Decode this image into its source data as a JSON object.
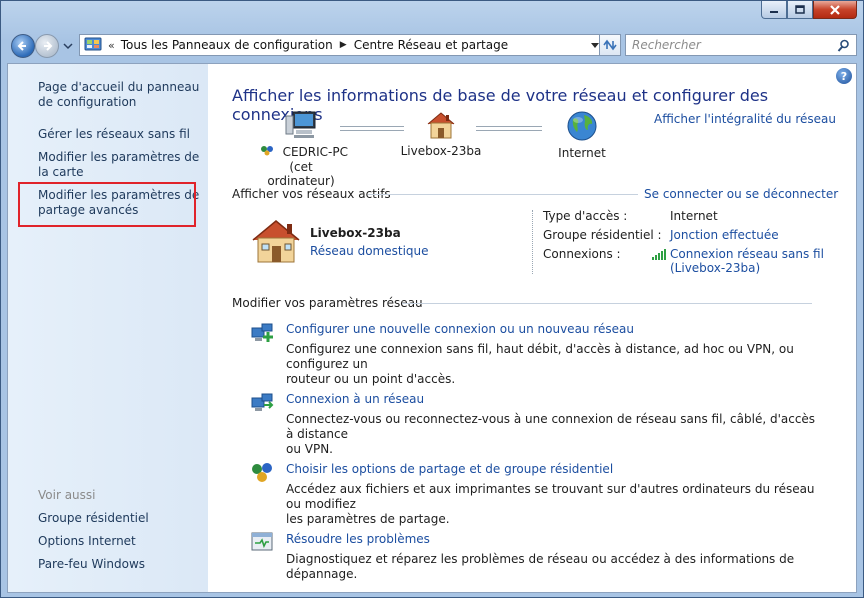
{
  "window": {
    "caption_buttons": [
      "minimize-icon",
      "maximize-icon",
      "close-icon"
    ]
  },
  "address_bar": {
    "overflow": "«",
    "crumbs": [
      "Tous les Panneaux de configuration",
      "Centre Réseau et partage"
    ],
    "search_placeholder": "Rechercher"
  },
  "sidebar": {
    "links": [
      "Page d'accueil du panneau de configuration",
      "Gérer les réseaux sans fil",
      "Modifier les paramètres de la carte",
      "Modifier les paramètres de partage avancés"
    ],
    "see_also_label": "Voir aussi",
    "see_also": [
      "Groupe résidentiel",
      "Options Internet",
      "Pare-feu Windows"
    ]
  },
  "main": {
    "help": "?",
    "title": "Afficher les informations de base de votre réseau et configurer des connexions",
    "full_map_link": "Afficher l'intégralité du réseau",
    "map": {
      "computer_name": "CEDRIC-PC",
      "computer_sub": "(cet ordinateur)",
      "router": "Livebox-23ba",
      "internet": "Internet"
    },
    "active_networks_header": "Afficher vos réseaux actifs",
    "connect_link": "Se connecter ou se déconnecter",
    "active_network": {
      "name": "Livebox-23ba",
      "type": "Réseau domestique",
      "access_type_label": "Type d'accès :",
      "access_type_value": "Internet",
      "homegroup_label": "Groupe résidentiel :",
      "homegroup_value": "Jonction effectuée",
      "connections_label": "Connexions :",
      "connection_line1": "Connexion réseau sans fil",
      "connection_line2": "(Livebox-23ba)"
    },
    "settings_header": "Modifier vos paramètres réseau",
    "tasks": [
      {
        "title": "Configurer une nouvelle connexion ou un nouveau réseau",
        "desc1": "Configurez une connexion sans fil, haut débit, d'accès à distance, ad hoc ou VPN, ou configurez un",
        "desc2": "routeur ou un point d'accès."
      },
      {
        "title": "Connexion à un réseau",
        "desc1": "Connectez-vous ou reconnectez-vous à une connexion de réseau sans fil, câblé, d'accès à distance",
        "desc2": "ou VPN."
      },
      {
        "title": "Choisir les options de partage et de groupe résidentiel",
        "desc1": "Accédez aux fichiers et aux imprimantes se trouvant sur d'autres ordinateurs du réseau ou modifiez",
        "desc2": "les paramètres de partage."
      },
      {
        "title": "Résoudre les problèmes",
        "desc1": "Diagnostiquez et réparez les problèmes de réseau ou accédez à des informations de dépannage.",
        "desc2": ""
      }
    ]
  },
  "colors": {
    "link": "#1c4ea0",
    "title": "#1e3287",
    "sidebar_bg": "#dbe8f6",
    "highlight": "#e0232a"
  }
}
